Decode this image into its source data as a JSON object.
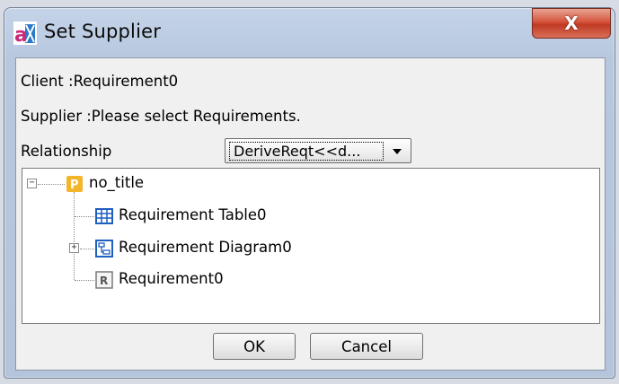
{
  "window": {
    "title": "Set Supplier",
    "close_label": "X"
  },
  "dialog": {
    "client_label": "Client :Requirement0",
    "supplier_label": "Supplier :Please select Requirements.",
    "relationship_label": "Relationship",
    "relationship_value": "DeriveReqt<<d..."
  },
  "tree": {
    "root": {
      "label": "no_title",
      "icon": "package-icon",
      "expander": "−"
    },
    "children": [
      {
        "label": "Requirement Table0",
        "icon": "table-icon"
      },
      {
        "label": "Requirement Diagram0",
        "icon": "diagram-icon",
        "expander": "+"
      },
      {
        "label": "Requirement0",
        "icon": "requirement-icon"
      }
    ],
    "package_icon_letter": "P",
    "requirement_icon_letter": "R"
  },
  "buttons": {
    "ok": "OK",
    "cancel": "Cancel"
  },
  "colors": {
    "close_button": "#c03a22",
    "package_icon": "#f2b52b",
    "table_icon": "#1f5fbf",
    "diagram_icon": "#1f5fbf"
  }
}
